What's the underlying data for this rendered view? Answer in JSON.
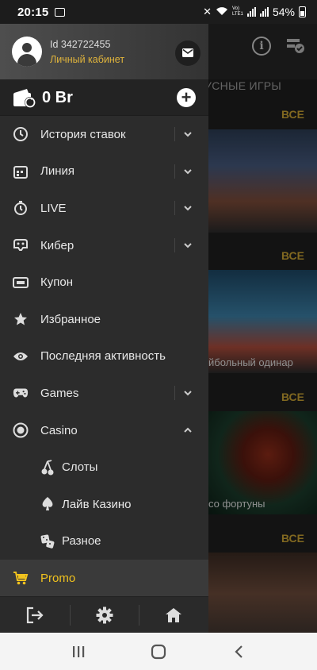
{
  "status_bar": {
    "time": "20:15",
    "network_label": "Vo) LTE1",
    "battery": "54%"
  },
  "background": {
    "section_title": "УСНЫЕ ИГРЫ",
    "see_all": [
      "ВСЕ",
      "ВСЕ",
      "ВСЕ",
      "ВСЕ"
    ],
    "cards": [
      {
        "caption": ""
      },
      {
        "caption": "йбольный одинар"
      },
      {
        "caption": "со фортуны"
      },
      {
        "caption": ""
      }
    ]
  },
  "profile": {
    "id_text": "Id 342722455",
    "cabinet_link": "Личный кабинет"
  },
  "balance": {
    "amount": "0 Br"
  },
  "menu": {
    "items": [
      {
        "label": "История ставок",
        "icon": "history-icon",
        "expandable": true
      },
      {
        "label": "Линия",
        "icon": "calendar-icon",
        "expandable": true
      },
      {
        "label": "LIVE",
        "icon": "stopwatch-icon",
        "expandable": true
      },
      {
        "label": "Кибер",
        "icon": "cyber-gamepad-icon",
        "expandable": true
      },
      {
        "label": "Купон",
        "icon": "ticket-icon",
        "expandable": false
      },
      {
        "label": "Избранное",
        "icon": "star-icon",
        "expandable": false
      },
      {
        "label": "Последняя активность",
        "icon": "eye-icon",
        "expandable": false
      },
      {
        "label": "Games",
        "icon": "gamepad-icon",
        "expandable": true
      },
      {
        "label": "Casino",
        "icon": "casino-chip-icon",
        "expandable": true,
        "expanded": true
      }
    ],
    "sub_items": [
      {
        "label": "Слоты",
        "icon": "cherry-icon"
      },
      {
        "label": "Лайв Казино",
        "icon": "spade-icon"
      },
      {
        "label": "Разное",
        "icon": "dice-icon"
      }
    ],
    "promo": {
      "label": "Promo",
      "icon": "cart-icon"
    }
  },
  "bottom_actions": [
    "logout-icon",
    "settings-icon",
    "home-icon"
  ],
  "colors": {
    "accent": "#f0c21e",
    "drawer_bg": "#2c2c2c",
    "see_all": "#c7a032"
  }
}
